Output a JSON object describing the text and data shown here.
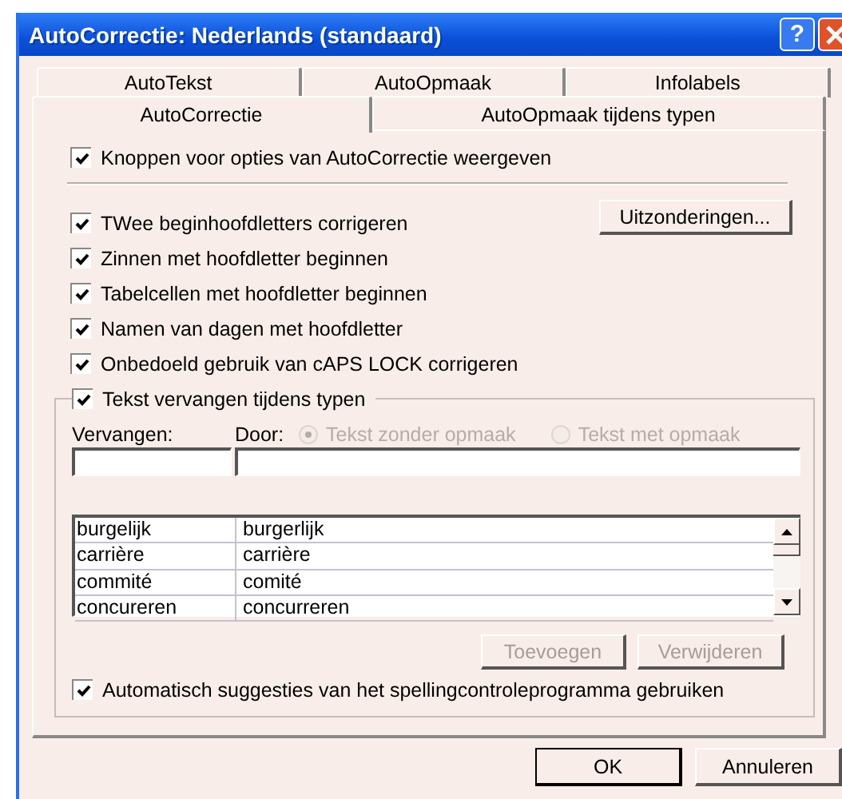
{
  "window": {
    "title": "AutoCorrectie: Nederlands (standaard)",
    "help_button": "?"
  },
  "tab_rows": [
    {
      "tabs": [
        {
          "label": "AutoTekst",
          "selected": false
        },
        {
          "label": "AutoOpmaak",
          "selected": false
        },
        {
          "label": "Infolabels",
          "selected": false
        }
      ]
    },
    {
      "tabs": [
        {
          "label": "AutoCorrectie",
          "selected": true
        },
        {
          "label": "AutoOpmaak tijdens typen",
          "selected": false
        }
      ]
    }
  ],
  "show_buttons_option": {
    "label": "Knoppen voor opties van AutoCorrectie weergeven",
    "checked": true
  },
  "options": [
    {
      "label": "TWee beginhoofdletters corrigeren",
      "checked": true
    },
    {
      "label": "Zinnen met hoofdletter beginnen",
      "checked": true
    },
    {
      "label": "Tabelcellen met hoofdletter beginnen",
      "checked": true
    },
    {
      "label": "Namen van dagen met hoofdletter",
      "checked": true
    },
    {
      "label": "Onbedoeld gebruik van cAPS LOCK corrigeren",
      "checked": true
    }
  ],
  "exceptions_button": "Uitzonderingen...",
  "replace_group": {
    "label": "Tekst vervangen tijdens typen",
    "checked": true,
    "replace_label": "Vervangen:",
    "with_label": "Door:",
    "format_options": [
      {
        "label": "Tekst zonder opmaak",
        "selected": true,
        "disabled": true
      },
      {
        "label": "Tekst met opmaak",
        "selected": false,
        "disabled": true
      }
    ],
    "entries": [
      {
        "replace": "burgelijk",
        "with": "burgerlijk"
      },
      {
        "replace": "carrière",
        "with": "carrière"
      },
      {
        "replace": "commité",
        "with": "comité"
      },
      {
        "replace": "concureren",
        "with": "concurreren"
      }
    ],
    "buttons": [
      {
        "label": "Toevoegen",
        "disabled": true
      },
      {
        "label": "Verwijderen",
        "disabled": true
      }
    ],
    "suggestions_option": {
      "label": "Automatisch suggesties van het spellingcontroleprogramma gebruiken",
      "checked": true
    }
  },
  "buttons": [
    {
      "label": "OK",
      "default": true
    },
    {
      "label": "Annuleren",
      "default": false
    }
  ]
}
